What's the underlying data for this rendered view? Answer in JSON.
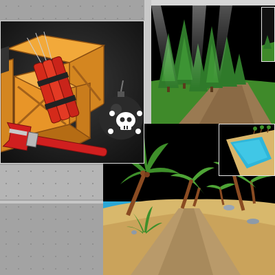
{
  "scenes": [
    {
      "name": "props",
      "items": [
        "wooden-crate",
        "dynamite",
        "bomb",
        "pipe-wrench"
      ]
    },
    {
      "name": "forest",
      "items": [
        "pine-trees",
        "dirt-path",
        "light-rays"
      ]
    },
    {
      "name": "beach",
      "items": [
        "palm-trees",
        "sand-path",
        "rocks",
        "water-inset"
      ]
    }
  ],
  "colors": {
    "background": "#a9a9a9",
    "crate": "#e08a1e",
    "dynamite": "#d42a1a",
    "bomb": "#2a2a2a",
    "wrench": "#d01f1f",
    "forest_green": "#2f7a2a",
    "sand": "#d9b66a",
    "water": "#2fb6d9"
  }
}
